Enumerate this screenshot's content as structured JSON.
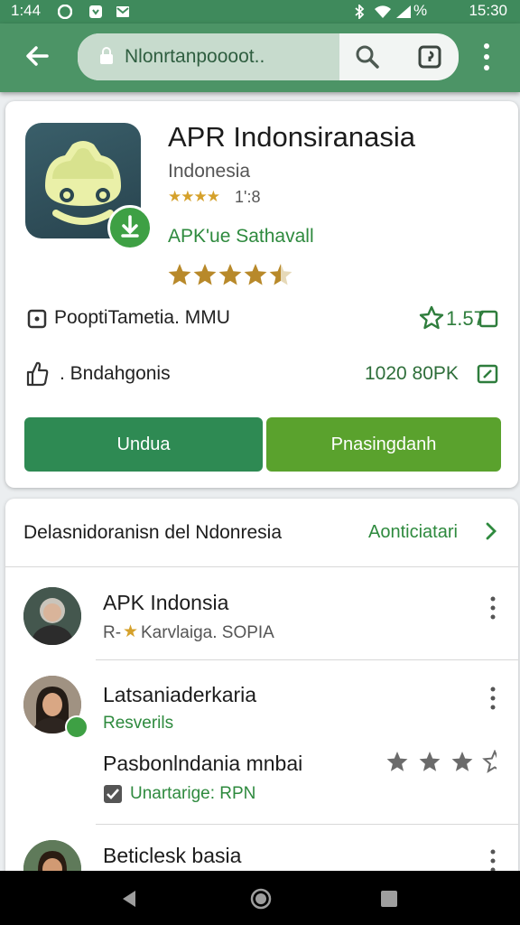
{
  "status_bar": {
    "time_left": "1:44",
    "battery": "%",
    "time_right": "15:30"
  },
  "browser": {
    "url": "Nlonrtanpoooot..",
    "icons": [
      "back-arrow-icon",
      "lock-icon",
      "search-icon",
      "tab-switcher-icon",
      "overflow-menu-icon"
    ]
  },
  "app": {
    "title": "APR Indonsiranasia",
    "subtitle": "Indonesia",
    "small_rating_stars": "★★★★",
    "small_rating_text": "1':8",
    "developer": "APK'ue Sathavall",
    "star_rating": 4.5,
    "info_row_1": {
      "label": "PooptiTametia. MMU",
      "value": "1.57"
    },
    "info_row_2": {
      "label": ". Bndahgonis",
      "value": "1020 80PK"
    },
    "button_primary": "Undua",
    "button_secondary": "Pnasingdanh"
  },
  "list_section": {
    "title": "Delasnidoranisn del Ndonresia",
    "link": "Aonticiatari",
    "items": [
      {
        "title": "APK Indonsia",
        "sub_prefix": "R-",
        "sub_star": "★",
        "sub_text": "Karvlaiga. SOPIA"
      },
      {
        "title": "Latsaniaderkaria",
        "sub": "Resverils",
        "detail": "Pasbonlndania mnbai",
        "check_text": "Unartarige: RPN",
        "rating": 3
      },
      {
        "title": "Beticlesk basia"
      }
    ]
  },
  "colors": {
    "status_bar": "#3f8a5c",
    "app_bar": "#4c9466",
    "primary_button": "#2e8a53",
    "secondary_button": "#5aa22d",
    "accent_green": "#2e8a3e",
    "star_gold": "#d5a12b"
  }
}
